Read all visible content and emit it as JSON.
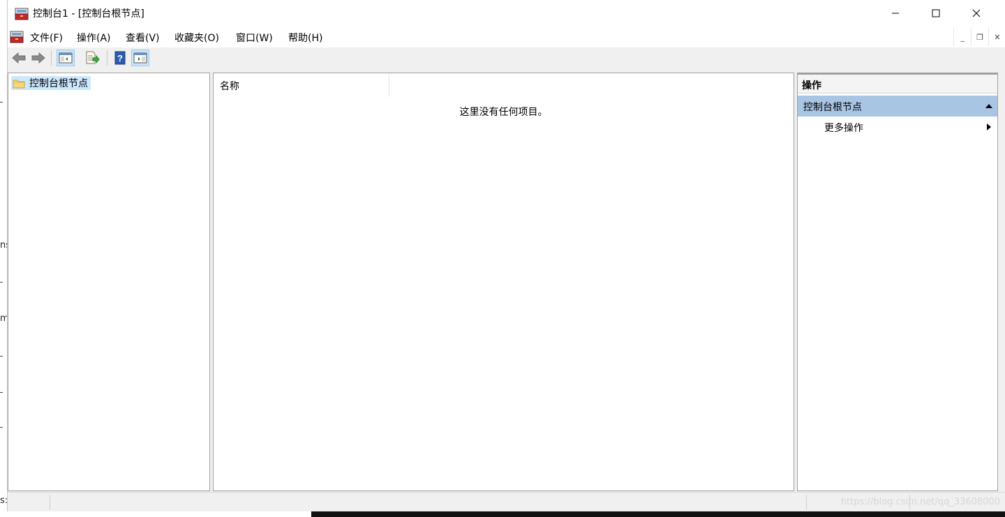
{
  "background": {
    "left_fragments": [
      "ns",
      "m",
      "s:"
    ]
  },
  "window": {
    "title": "控制台1 - [控制台根节点]",
    "title_icon": "mmc-toolbox-icon",
    "controls": {
      "minimize": "minimize-icon",
      "maximize": "maximize-icon",
      "close": "close-icon"
    }
  },
  "menubar": {
    "items": [
      {
        "label": "文件(F)"
      },
      {
        "label": "操作(A)"
      },
      {
        "label": "查看(V)"
      },
      {
        "label": "收藏夹(O)"
      },
      {
        "label": "窗口(W)"
      },
      {
        "label": "帮助(H)"
      }
    ],
    "mdi": {
      "minimize": "_",
      "restore": "❐",
      "close": "✕"
    }
  },
  "toolbar": {
    "buttons": [
      "back-arrow-icon",
      "forward-arrow-icon",
      "show-hide-tree-icon",
      "export-list-icon",
      "help-icon",
      "show-hide-action-pane-icon"
    ]
  },
  "tree": {
    "root_label": "控制台根节点"
  },
  "content": {
    "column_header": "名称",
    "empty_message": "这里没有任何项目。"
  },
  "actions": {
    "title": "操作",
    "section_label": "控制台根节点",
    "more_actions": "更多操作"
  },
  "statusbar": {
    "watermark": "https://blog.csdn.net/qq_33608000"
  },
  "colors": {
    "selection": "#cce8ff",
    "action_section": "#a8c5e4",
    "toolbar_bg": "#f0f0f0"
  }
}
